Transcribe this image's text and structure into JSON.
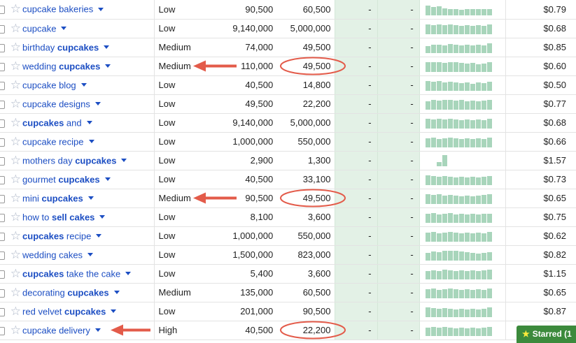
{
  "rows": [
    {
      "kw": [
        {
          "t": "cupcake bakeries",
          "b": false
        }
      ],
      "comp": "Low",
      "global": "90,500",
      "local": "60,500",
      "g1": "-",
      "g2": "-",
      "trend": [
        0.85,
        0.7,
        0.75,
        0.6,
        0.55,
        0.5,
        0.45,
        0.55,
        0.55,
        0.5,
        0.5,
        0.55
      ],
      "cpc": "$0.79"
    },
    {
      "kw": [
        {
          "t": "cupcake",
          "b": false
        }
      ],
      "comp": "Low",
      "global": "9,140,000",
      "local": "5,000,000",
      "g1": "-",
      "g2": "-",
      "trend": [
        0.85,
        0.75,
        0.8,
        0.75,
        0.8,
        0.75,
        0.7,
        0.75,
        0.7,
        0.75,
        0.7,
        0.8
      ],
      "cpc": "$0.68"
    },
    {
      "kw": [
        {
          "t": "birthday ",
          "b": false
        },
        {
          "t": "cupcakes",
          "b": true
        }
      ],
      "comp": "Medium",
      "global": "74,000",
      "local": "49,500",
      "g1": "-",
      "g2": "-",
      "trend": [
        0.6,
        0.7,
        0.7,
        0.65,
        0.75,
        0.7,
        0.65,
        0.7,
        0.65,
        0.7,
        0.65,
        0.85
      ],
      "cpc": "$0.85"
    },
    {
      "kw": [
        {
          "t": "wedding ",
          "b": false
        },
        {
          "t": "cupcakes",
          "b": true
        }
      ],
      "comp": "Medium",
      "global": "110,000",
      "local": "49,500",
      "g1": "-",
      "g2": "-",
      "trend": [
        0.8,
        0.85,
        0.8,
        0.75,
        0.8,
        0.85,
        0.75,
        0.7,
        0.75,
        0.65,
        0.7,
        0.8
      ],
      "cpc": "$0.60"
    },
    {
      "kw": [
        {
          "t": "cupcake blog",
          "b": false
        }
      ],
      "comp": "Low",
      "global": "40,500",
      "local": "14,800",
      "g1": "-",
      "g2": "-",
      "trend": [
        0.85,
        0.75,
        0.8,
        0.7,
        0.75,
        0.7,
        0.65,
        0.7,
        0.6,
        0.7,
        0.65,
        0.75
      ],
      "cpc": "$0.50"
    },
    {
      "kw": [
        {
          "t": "cupcake designs",
          "b": false
        }
      ],
      "comp": "Low",
      "global": "49,500",
      "local": "22,200",
      "g1": "-",
      "g2": "-",
      "trend": [
        0.7,
        0.8,
        0.75,
        0.85,
        0.8,
        0.75,
        0.8,
        0.7,
        0.75,
        0.7,
        0.75,
        0.8
      ],
      "cpc": "$0.77"
    },
    {
      "kw": [
        {
          "t": "cupcakes",
          "b": true
        },
        {
          "t": " and",
          "b": false
        }
      ],
      "comp": "Low",
      "global": "9,140,000",
      "local": "5,000,000",
      "g1": "-",
      "g2": "-",
      "trend": [
        0.85,
        0.75,
        0.8,
        0.75,
        0.8,
        0.75,
        0.7,
        0.75,
        0.7,
        0.75,
        0.7,
        0.8
      ],
      "cpc": "$0.68"
    },
    {
      "kw": [
        {
          "t": "cupcake recipe",
          "b": false
        }
      ],
      "comp": "Low",
      "global": "1,000,000",
      "local": "550,000",
      "g1": "-",
      "g2": "-",
      "trend": [
        0.75,
        0.8,
        0.7,
        0.75,
        0.8,
        0.75,
        0.7,
        0.75,
        0.7,
        0.75,
        0.7,
        0.85
      ],
      "cpc": "$0.66"
    },
    {
      "kw": [
        {
          "t": "mothers day ",
          "b": false
        },
        {
          "t": "cupcakes",
          "b": true
        }
      ],
      "comp": "Low",
      "global": "2,900",
      "local": "1,300",
      "g1": "-",
      "g2": "-",
      "trend": [
        0,
        0,
        0.35,
        0.95,
        0,
        0,
        0,
        0,
        0,
        0,
        0,
        0
      ],
      "cpc": "$1.57"
    },
    {
      "kw": [
        {
          "t": "gourmet ",
          "b": false
        },
        {
          "t": "cupcakes",
          "b": true
        }
      ],
      "comp": "Low",
      "global": "40,500",
      "local": "33,100",
      "g1": "-",
      "g2": "-",
      "trend": [
        0.8,
        0.75,
        0.7,
        0.75,
        0.7,
        0.65,
        0.7,
        0.65,
        0.7,
        0.65,
        0.7,
        0.75
      ],
      "cpc": "$0.73"
    },
    {
      "kw": [
        {
          "t": "mini ",
          "b": false
        },
        {
          "t": "cupcakes",
          "b": true
        }
      ],
      "comp": "Medium",
      "global": "90,500",
      "local": "49,500",
      "g1": "-",
      "g2": "-",
      "trend": [
        0.8,
        0.75,
        0.8,
        0.7,
        0.75,
        0.7,
        0.65,
        0.7,
        0.65,
        0.7,
        0.75,
        0.85
      ],
      "cpc": "$0.65"
    },
    {
      "kw": [
        {
          "t": "how to ",
          "b": false
        },
        {
          "t": "sell cakes",
          "b": true
        }
      ],
      "comp": "Low",
      "global": "8,100",
      "local": "3,600",
      "g1": "-",
      "g2": "-",
      "trend": [
        0.75,
        0.8,
        0.7,
        0.75,
        0.8,
        0.7,
        0.75,
        0.7,
        0.75,
        0.7,
        0.75,
        0.75
      ],
      "cpc": "$0.75"
    },
    {
      "kw": [
        {
          "t": "cupcakes",
          "b": true
        },
        {
          "t": " recipe",
          "b": false
        }
      ],
      "comp": "Low",
      "global": "1,000,000",
      "local": "550,000",
      "g1": "-",
      "g2": "-",
      "trend": [
        0.75,
        0.8,
        0.7,
        0.75,
        0.8,
        0.75,
        0.7,
        0.75,
        0.7,
        0.75,
        0.7,
        0.85
      ],
      "cpc": "$0.62"
    },
    {
      "kw": [
        {
          "t": "wedding cakes",
          "b": false
        }
      ],
      "comp": "Low",
      "global": "1,500,000",
      "local": "823,000",
      "g1": "-",
      "g2": "-",
      "trend": [
        0.65,
        0.75,
        0.7,
        0.8,
        0.85,
        0.8,
        0.75,
        0.7,
        0.65,
        0.6,
        0.65,
        0.7
      ],
      "cpc": "$0.82"
    },
    {
      "kw": [
        {
          "t": "cupcakes",
          "b": true
        },
        {
          "t": " take the cake",
          "b": false
        }
      ],
      "comp": "Low",
      "global": "5,400",
      "local": "3,600",
      "g1": "-",
      "g2": "-",
      "trend": [
        0.7,
        0.75,
        0.7,
        0.8,
        0.75,
        0.7,
        0.75,
        0.7,
        0.75,
        0.7,
        0.75,
        0.8
      ],
      "cpc": "$1.15"
    },
    {
      "kw": [
        {
          "t": "decorating ",
          "b": false
        },
        {
          "t": "cupcakes",
          "b": true
        }
      ],
      "comp": "Medium",
      "global": "135,000",
      "local": "60,500",
      "g1": "-",
      "g2": "-",
      "trend": [
        0.75,
        0.8,
        0.7,
        0.75,
        0.8,
        0.75,
        0.7,
        0.75,
        0.7,
        0.75,
        0.7,
        0.8
      ],
      "cpc": "$0.65"
    },
    {
      "kw": [
        {
          "t": "red velvet ",
          "b": false
        },
        {
          "t": "cupcakes",
          "b": true
        }
      ],
      "comp": "Low",
      "global": "201,000",
      "local": "90,500",
      "g1": "-",
      "g2": "-",
      "trend": [
        0.8,
        0.75,
        0.7,
        0.75,
        0.7,
        0.65,
        0.7,
        0.65,
        0.7,
        0.65,
        0.7,
        0.85
      ],
      "cpc": "$0.87"
    },
    {
      "kw": [
        {
          "t": "cupcake delivery",
          "b": false
        }
      ],
      "comp": "High",
      "global": "40,500",
      "local": "22,200",
      "g1": "-",
      "g2": "-",
      "trend": [
        0.7,
        0.75,
        0.7,
        0.75,
        0.7,
        0.65,
        0.7,
        0.65,
        0.7,
        0.65,
        0.7,
        0.75
      ],
      "cpc": ""
    }
  ],
  "annotations": {
    "arrow_rows": [
      3,
      10,
      17
    ],
    "circle_rows": [
      3,
      10,
      17
    ],
    "color": "#e35b4a"
  },
  "starred_label": "Starred (1",
  "colors": {
    "link": "#1c4ec3",
    "trend": "#a8d5bb",
    "band": "#e3f1e6",
    "starred_bg": "#3c8a3c"
  }
}
